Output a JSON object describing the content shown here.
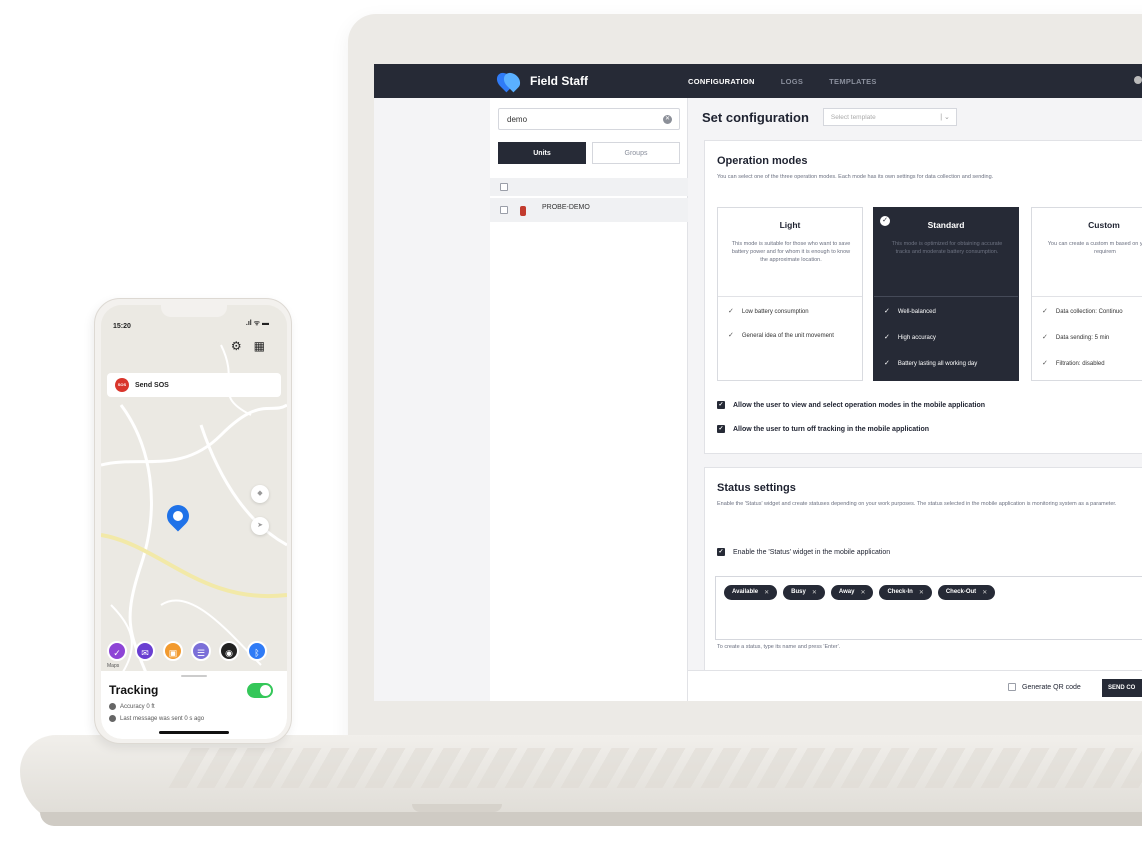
{
  "nav": {
    "brand": "Field Staff",
    "tabs": [
      "CONFIGURATION",
      "LOGS",
      "TEMPLATES"
    ]
  },
  "sidebar": {
    "search_value": "demo",
    "segments": [
      "Units",
      "Groups"
    ],
    "unit_name": "PROBE-DEMO"
  },
  "main": {
    "title": "Set configuration",
    "template_placeholder": "Select template"
  },
  "operation_modes": {
    "title": "Operation modes",
    "description": "You can select one of the three operation modes. Each mode has its own settings for data collection and sending.",
    "modes": [
      {
        "name": "Light",
        "description": "This mode is suitable for those who want to save battery power and for whom it is enough to know the approximate location.",
        "features": [
          "Low battery consumption",
          "General idea of the unit movement"
        ]
      },
      {
        "name": "Standard",
        "description": "This mode is optimized for obtaining accurate tracks and moderate battery consumption.",
        "features": [
          "Well-balanced",
          "High accuracy",
          "Battery lasting all working day"
        ]
      },
      {
        "name": "Custom",
        "description": "You can create a custom m based on your own requirem",
        "features": [
          "Data collection: Continuo",
          "Data sending: 5 min",
          "Filtration: disabled"
        ]
      }
    ],
    "options": [
      "Allow the user to view and select operation modes in the mobile application",
      "Allow the user to turn off tracking in the mobile application"
    ]
  },
  "status_settings": {
    "title": "Status settings",
    "description": "Enable the 'Status' widget and create statuses depending on your work purposes. The status selected in the mobile application is monitoring system as a parameter.",
    "enable_label": "Enable the 'Status' widget in the mobile application",
    "chips": [
      "Available",
      "Busy",
      "Away",
      "Check-In",
      "Check-Out"
    ],
    "hint": "To create a status, type its name and press 'Enter'."
  },
  "footer": {
    "qr_label": "Generate QR code",
    "send_label": "SEND CO"
  },
  "phone": {
    "time": "15:20",
    "sos_label": "Send SOS",
    "sos_badge": "SOS",
    "maps_label": "Maps",
    "tracking_title": "Tracking",
    "accuracy": "Accuracy 0 ft",
    "last_message": "Last message was sent 0 s ago",
    "tracking_on": true
  },
  "colors": {
    "dark": "#262a36",
    "accent_blue": "#2f7bf6",
    "toggle_green": "#34c759",
    "sos_red": "#d9352b"
  }
}
